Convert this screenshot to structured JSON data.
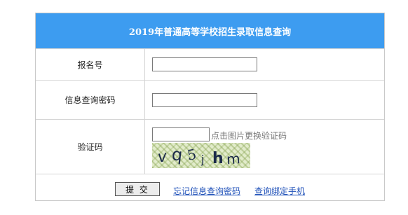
{
  "form": {
    "title": "2019年普通高等学校招生录取信息查询",
    "rows": [
      {
        "label": "报名号",
        "value": "",
        "placeholder": ""
      },
      {
        "label": "信息查询密码",
        "value": "",
        "placeholder": ""
      },
      {
        "label": "验证码",
        "value": "",
        "placeholder": ""
      }
    ],
    "captcha_hint": "点击图片更换验证码",
    "captcha_text": [
      "v",
      "q",
      "5",
      "j",
      "h",
      "m"
    ],
    "submit_label": "提 交",
    "forgot_password_link": "忘记信息查询密码",
    "bind_phone_link": "查询绑定手机"
  },
  "colors": {
    "header_bg": "#3d9cf0",
    "link": "#1d4fb8",
    "border": "#c9c9c9"
  }
}
